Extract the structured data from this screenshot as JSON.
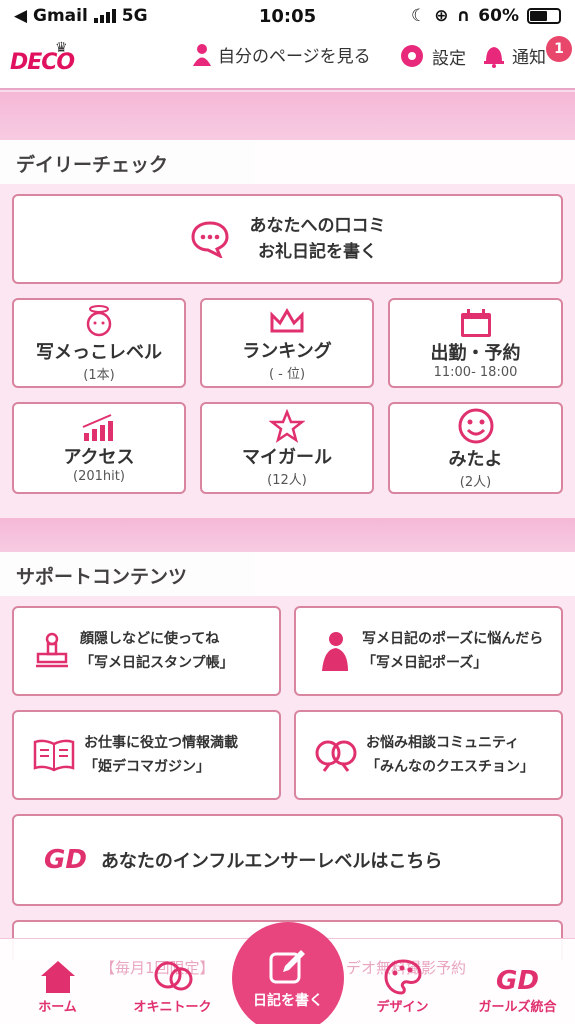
{
  "statusbar": {
    "back_app": "◀ Gmail",
    "network": "5G",
    "time": "10:05",
    "battery": "60%"
  },
  "header": {
    "logo": "DECO",
    "my_page": "自分のページを見る",
    "settings": "設定",
    "notifications": "通知",
    "badge": "1"
  },
  "daily": {
    "title": "デイリーチェック",
    "review": {
      "line1": "あなたへの口コミ",
      "line2": "お礼日記を書く"
    },
    "tiles": [
      {
        "label": "写メっこレベル",
        "sub": "(1本)"
      },
      {
        "label": "ランキング",
        "sub": "( - 位)"
      },
      {
        "label": "出勤・予約",
        "sub": "11:00- 18:00"
      },
      {
        "label": "アクセス",
        "sub": "(201hit)"
      },
      {
        "label": "マイガール",
        "sub": "(12人)"
      },
      {
        "label": "みたよ",
        "sub": "(2人)"
      }
    ]
  },
  "support": {
    "title": "サポートコンテンツ",
    "cards": [
      {
        "line1": "顔隠しなどに使ってね",
        "line2": "「写メ日記スタンプ帳」"
      },
      {
        "line1": "写メ日記のポーズに悩んだら",
        "line2": "「写メ日記ポーズ」"
      },
      {
        "line1": "お仕事に役立つ情報満載",
        "line2": "「姫デコマガジン」"
      },
      {
        "line1": "お悩み相談コミュニティ",
        "line2": "「みんなのクエスチョン」"
      }
    ],
    "influencer": "あなたのインフルエンサーレベルはこちら"
  },
  "ghost_banner": "【毎月1回限定】",
  "ghost_banner2": "デオ無料撮影予約",
  "tabs": [
    {
      "label": "ホーム"
    },
    {
      "label": "オキニトーク"
    },
    {
      "label": "日記を書く"
    },
    {
      "label": "デザイン"
    },
    {
      "label": "ガールズ統合"
    }
  ]
}
